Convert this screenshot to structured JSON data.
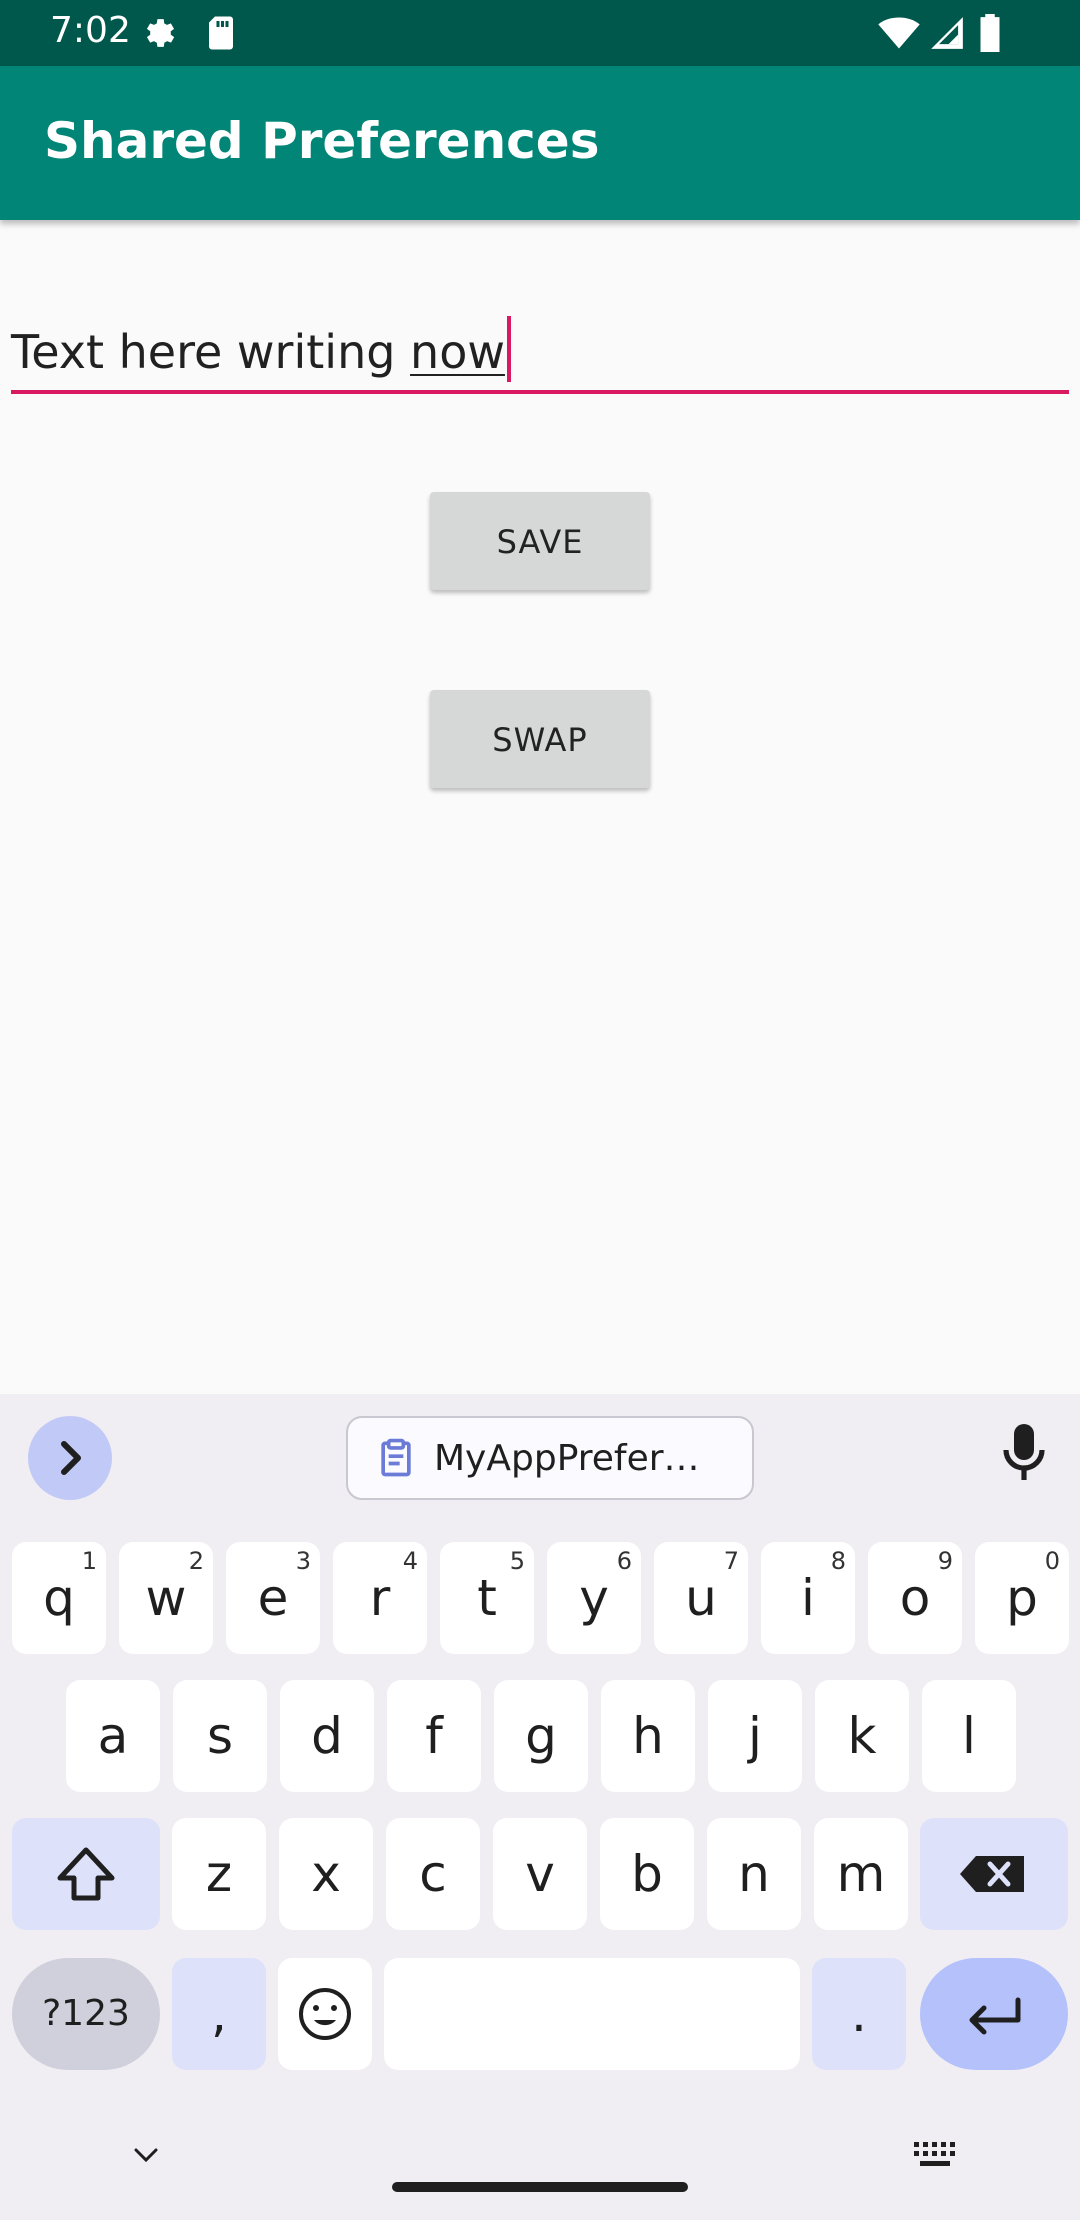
{
  "status_bar": {
    "time": "7:02",
    "icons": [
      "settings-icon",
      "sd-card-icon",
      "wifi-icon",
      "signal-icon",
      "battery-icon"
    ]
  },
  "app_bar": {
    "title": "Shared Preferences",
    "color": "#008577"
  },
  "edit_field": {
    "value_prefix": "Text here writing ",
    "value_composing": "now",
    "accent_color": "#d81b60"
  },
  "buttons": {
    "save_label": "SAVE",
    "swap_label": "SWAP"
  },
  "keyboard": {
    "clipboard_suggestion": "MyAppPrefer…",
    "row1": [
      {
        "key": "q",
        "hint": "1"
      },
      {
        "key": "w",
        "hint": "2"
      },
      {
        "key": "e",
        "hint": "3"
      },
      {
        "key": "r",
        "hint": "4"
      },
      {
        "key": "t",
        "hint": "5"
      },
      {
        "key": "y",
        "hint": "6"
      },
      {
        "key": "u",
        "hint": "7"
      },
      {
        "key": "i",
        "hint": "8"
      },
      {
        "key": "o",
        "hint": "9"
      },
      {
        "key": "p",
        "hint": "0"
      }
    ],
    "row2": [
      "a",
      "s",
      "d",
      "f",
      "g",
      "h",
      "j",
      "k",
      "l"
    ],
    "row3": [
      "z",
      "x",
      "c",
      "v",
      "b",
      "n",
      "m"
    ],
    "row4": {
      "symbols": "?123",
      "comma": ",",
      "period": "."
    }
  }
}
